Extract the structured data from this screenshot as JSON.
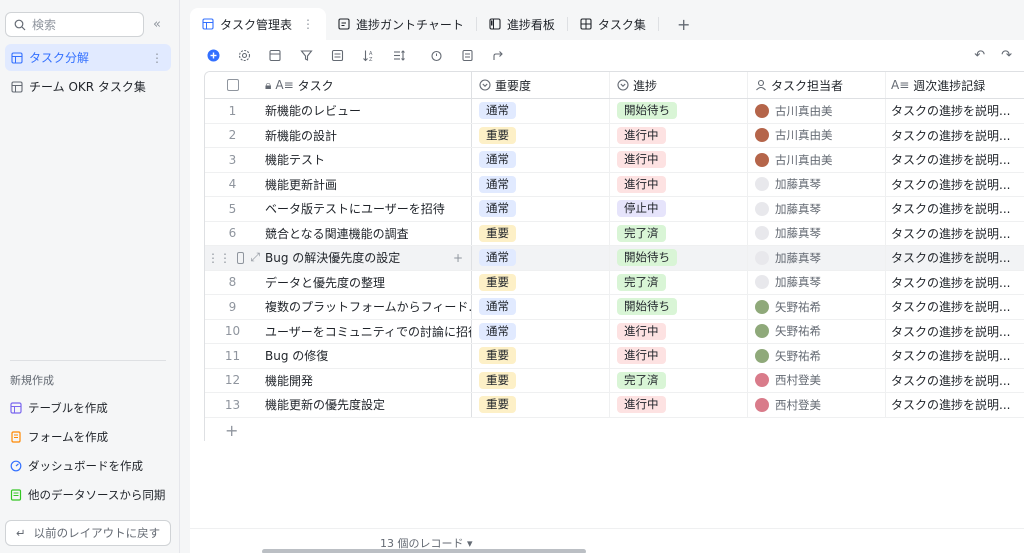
{
  "sidebar": {
    "search_placeholder": "検索",
    "collapse_icon": "double-chevron-left-icon",
    "items": [
      {
        "label": "タスク分解",
        "active": true
      },
      {
        "label": "チーム OKR タスク集",
        "active": false
      }
    ],
    "new_title": "新規作成",
    "create_items": [
      {
        "label": "テーブルを作成",
        "icon": "table-icon",
        "color": "#7b67ee"
      },
      {
        "label": "フォームを作成",
        "icon": "form-icon",
        "color": "#ff8800"
      },
      {
        "label": "ダッシュボードを作成",
        "icon": "dashboard-icon",
        "color": "#3370ff"
      },
      {
        "label": "他のデータソースから同期",
        "icon": "sync-icon",
        "color": "#34c724"
      }
    ],
    "back_label": "以前のレイアウトに戻す"
  },
  "tabs": [
    {
      "label": "タスク管理表",
      "active": true,
      "icon": "grid-icon"
    },
    {
      "label": "進捗ガントチャート",
      "active": false,
      "icon": "gantt-icon"
    },
    {
      "label": "進捗看板",
      "active": false,
      "icon": "kanban-icon"
    },
    {
      "label": "タスク集",
      "active": false,
      "icon": "gallery-icon"
    }
  ],
  "columns": {
    "task": "タスク",
    "importance": "重要度",
    "progress": "進捗",
    "owner": "タスク担当者",
    "weekly": "週次進捗記録"
  },
  "colors": {
    "accent": "#3370ff",
    "tag_normal_bg": "#e1eaff",
    "tag_normal_fg": "#1f2329",
    "tag_high_bg": "#fdf0c7",
    "tag_high_fg": "#1f2329",
    "tag_waiting_bg": "#d9f5d6",
    "tag_inprogress_bg": "#fde2e2",
    "tag_stopped_bg": "#e6e4fb",
    "tag_done_bg": "#d9f5d6"
  },
  "rows": [
    {
      "num": "1",
      "task": "新機能のレビュー",
      "importance": "通常",
      "progress": "開始待ち",
      "owner": "古川真由美",
      "weekly": "タスクの進捗を説明..."
    },
    {
      "num": "2",
      "task": "新機能の設計",
      "importance": "重要",
      "progress": "進行中",
      "owner": "古川真由美",
      "weekly": "タスクの進捗を説明..."
    },
    {
      "num": "3",
      "task": "機能テスト",
      "importance": "通常",
      "progress": "進行中",
      "owner": "古川真由美",
      "weekly": "タスクの進捗を説明..."
    },
    {
      "num": "4",
      "task": "機能更新計画",
      "importance": "通常",
      "progress": "進行中",
      "owner": "加藤真琴",
      "weekly": "タスクの進捗を説明..."
    },
    {
      "num": "5",
      "task": "ベータ版テストにユーザーを招待",
      "importance": "通常",
      "progress": "停止中",
      "owner": "加藤真琴",
      "weekly": "タスクの進捗を説明..."
    },
    {
      "num": "6",
      "task": "競合となる関連機能の調査",
      "importance": "重要",
      "progress": "完了済",
      "owner": "加藤真琴",
      "weekly": "タスクの進捗を説明..."
    },
    {
      "num": "",
      "task": "Bug の解決優先度の設定",
      "importance": "通常",
      "progress": "開始待ち",
      "owner": "加藤真琴",
      "weekly": "タスクの進捗を説明..."
    },
    {
      "num": "8",
      "task": "データと優先度の整理",
      "importance": "重要",
      "progress": "完了済",
      "owner": "加藤真琴",
      "weekly": "タスクの進捗を説明..."
    },
    {
      "num": "9",
      "task": "複数のプラットフォームからフィード...",
      "importance": "通常",
      "progress": "開始待ち",
      "owner": "矢野祐希",
      "weekly": "タスクの進捗を説明..."
    },
    {
      "num": "10",
      "task": "ユーザーをコミュニティでの討論に招待",
      "importance": "通常",
      "progress": "進行中",
      "owner": "矢野祐希",
      "weekly": "タスクの進捗を説明..."
    },
    {
      "num": "11",
      "task": "Bug の修復",
      "importance": "重要",
      "progress": "進行中",
      "owner": "矢野祐希",
      "weekly": "タスクの進捗を説明..."
    },
    {
      "num": "12",
      "task": "機能開発",
      "importance": "重要",
      "progress": "完了済",
      "owner": "西村登美",
      "weekly": "タスクの進捗を説明..."
    },
    {
      "num": "13",
      "task": "機能更新の優先度設定",
      "importance": "重要",
      "progress": "進行中",
      "owner": "西村登美",
      "weekly": "タスクの進捗を説明..."
    }
  ],
  "footer": {
    "record_count": "13 個のレコード"
  }
}
